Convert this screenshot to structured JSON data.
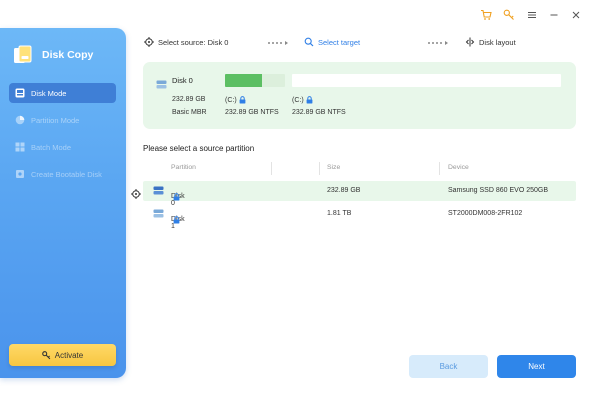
{
  "app": {
    "title": "Disk Copy"
  },
  "sidebar": {
    "items": [
      {
        "label": "Disk Mode",
        "icon": "disk-mode-icon",
        "state": "active"
      },
      {
        "label": "Partition Mode",
        "icon": "pie-chart-icon",
        "state": "disabled"
      },
      {
        "label": "Batch Mode",
        "icon": "grid-icon",
        "state": "disabled"
      },
      {
        "label": "Create Bootable Disk",
        "icon": "bootable-disk-icon",
        "state": "disabled"
      }
    ],
    "activate_label": "Activate"
  },
  "steps": {
    "source": "Select source: Disk 0",
    "target": "Select target",
    "layout": "Disk layout"
  },
  "disk_card": {
    "name": "Disk 0",
    "size": "232.89 GB",
    "type": "Basic MBR",
    "used_fraction": 0.62,
    "partitions": [
      {
        "label": "(C:)",
        "info": "232.89 GB NTFS"
      },
      {
        "label": "(C:)",
        "info": "232.89 GB NTFS"
      }
    ]
  },
  "table": {
    "title": "Please select a source partition",
    "columns": [
      "Partition",
      "Size",
      "Device"
    ],
    "rows": [
      {
        "partition": "Disk 0",
        "size": "232.89 GB",
        "device": "Samsung SSD 860 EVO 250GB",
        "selected": true
      },
      {
        "partition": "Disk 1",
        "size": "1.81 TB",
        "device": "ST2000DM008-2FR102",
        "selected": false
      }
    ]
  },
  "buttons": {
    "back": "Back",
    "next": "Next"
  },
  "colors": {
    "accent": "#2f86ea",
    "sidebar": "#5aa6f2",
    "selection": "#e8f7ea",
    "used": "#5cbf63",
    "activate": "#f7c640",
    "toolbar_icon": "#f0a020"
  }
}
